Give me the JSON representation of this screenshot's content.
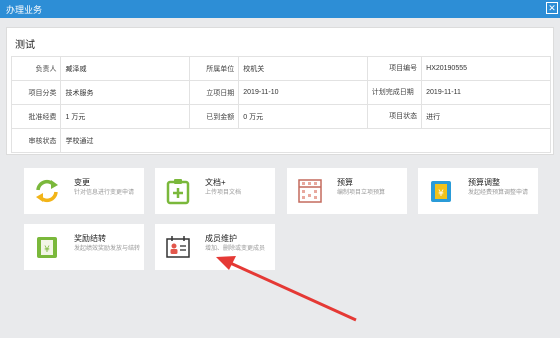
{
  "window": {
    "title": "办理业务",
    "close_glyph": "✕"
  },
  "project": {
    "title": "测试",
    "rows": [
      [
        {
          "label": "负责人",
          "value": "臧泽威"
        },
        {
          "label": "所属单位",
          "value": "校机关"
        },
        {
          "label": "项目编号",
          "value": "HX20190555"
        }
      ],
      [
        {
          "label": "项目分类",
          "value": "技术服务"
        },
        {
          "label": "立项日期",
          "value": "2019-11-10"
        },
        {
          "label": "计划完成日期",
          "value": "2019-11-11"
        }
      ],
      [
        {
          "label": "批准经费",
          "value": "1 万元"
        },
        {
          "label": "已到金额",
          "value": "0 万元"
        },
        {
          "label": "项目状态",
          "value": "进行"
        }
      ],
      [
        {
          "label": "审核状态",
          "value": "学校通过"
        }
      ]
    ]
  },
  "actions": [
    {
      "title": "变更",
      "desc": "针对信息进行变更申请",
      "icon": "refresh-icon",
      "color": "#7ab83b"
    },
    {
      "title": "文档+",
      "desc": "上传项目文档",
      "icon": "document-add-icon",
      "color": "#7ab83b"
    },
    {
      "title": "预算",
      "desc": "编制项目立项预算",
      "icon": "abacus-icon",
      "color": "#c46a5d"
    },
    {
      "title": "预算调整",
      "desc": "发起经费预算调整申请",
      "icon": "budget-adjust-icon",
      "color": "#2a9bd8"
    },
    {
      "title": "奖励结转",
      "desc": "发起绩效奖励发放与结转",
      "icon": "reward-icon",
      "color": "#7ab83b"
    },
    {
      "title": "成员维护",
      "desc": "增加、删除或变更成员",
      "icon": "member-card-icon",
      "color": "#333333"
    }
  ],
  "colors": {
    "titlebar": "#2d8ed6",
    "arrow": "#e53935"
  }
}
